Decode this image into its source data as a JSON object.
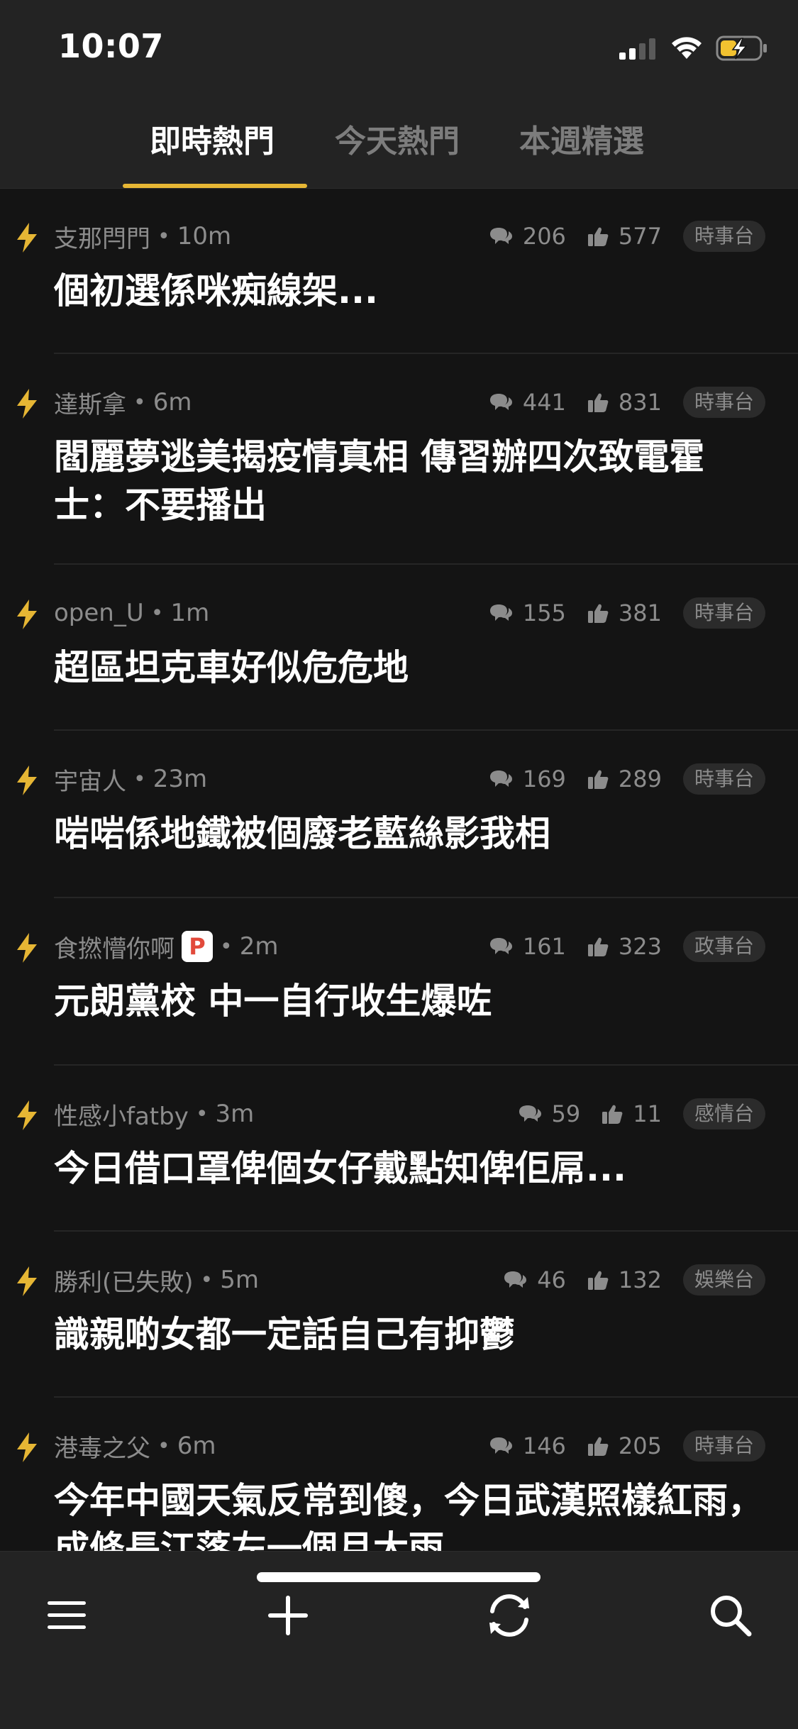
{
  "status_bar": {
    "time": "10:07"
  },
  "tabs": [
    {
      "label": "即時熱門",
      "active": true
    },
    {
      "label": "今天熱門",
      "active": false
    },
    {
      "label": "本週精選",
      "active": false
    }
  ],
  "colors": {
    "accent": "#e6b634",
    "background": "#141414",
    "header": "#232323",
    "muted": "#8c8c8c"
  },
  "posts": [
    {
      "user": "支那閂門",
      "time": "10m",
      "comments": "206",
      "likes": "577",
      "category": "時事台",
      "title": "個初選係咪痴線架..."
    },
    {
      "user": "達斯拿",
      "time": "6m",
      "comments": "441",
      "likes": "831",
      "category": "時事台",
      "title": "閻麗夢逃美揭疫情真相 傳習辦四次致電霍士：不要播出"
    },
    {
      "user": "open_U",
      "time": "1m",
      "comments": "155",
      "likes": "381",
      "category": "時事台",
      "title": "超區坦克車好似危危地"
    },
    {
      "user": "宇宙人",
      "time": "23m",
      "comments": "169",
      "likes": "289",
      "category": "時事台",
      "title": "啱啱係地鐵被個廢老藍絲影我相"
    },
    {
      "user": "食撚懵你啊",
      "badge": "P",
      "time": "2m",
      "comments": "161",
      "likes": "323",
      "category": "政事台",
      "title": "元朗黨校 中一自行收生爆咗"
    },
    {
      "user": "性感小fatby",
      "time": "3m",
      "comments": "59",
      "likes": "11",
      "category": "感情台",
      "title": "今日借口罩俾個女仔戴點知俾佢屌..."
    },
    {
      "user": "勝利(已失敗)",
      "time": "5m",
      "comments": "46",
      "likes": "132",
      "category": "娛樂台",
      "title": "識親啲女都一定話自己有抑鬱"
    },
    {
      "user": "港毒之父",
      "time": "6m",
      "comments": "146",
      "likes": "205",
      "category": "時事台",
      "title": "今年中國天氣反常到傻，今日武漢照樣紅雨，成條長江落左一個月大雨。"
    }
  ],
  "icons": {
    "post_marker": "lightning-bolt-icon",
    "comments": "speech-bubbles-icon",
    "likes": "thumbs-up-icon",
    "menu": "hamburger-menu-icon",
    "new_post": "plus-icon",
    "refresh": "refresh-icon",
    "search": "search-icon"
  }
}
